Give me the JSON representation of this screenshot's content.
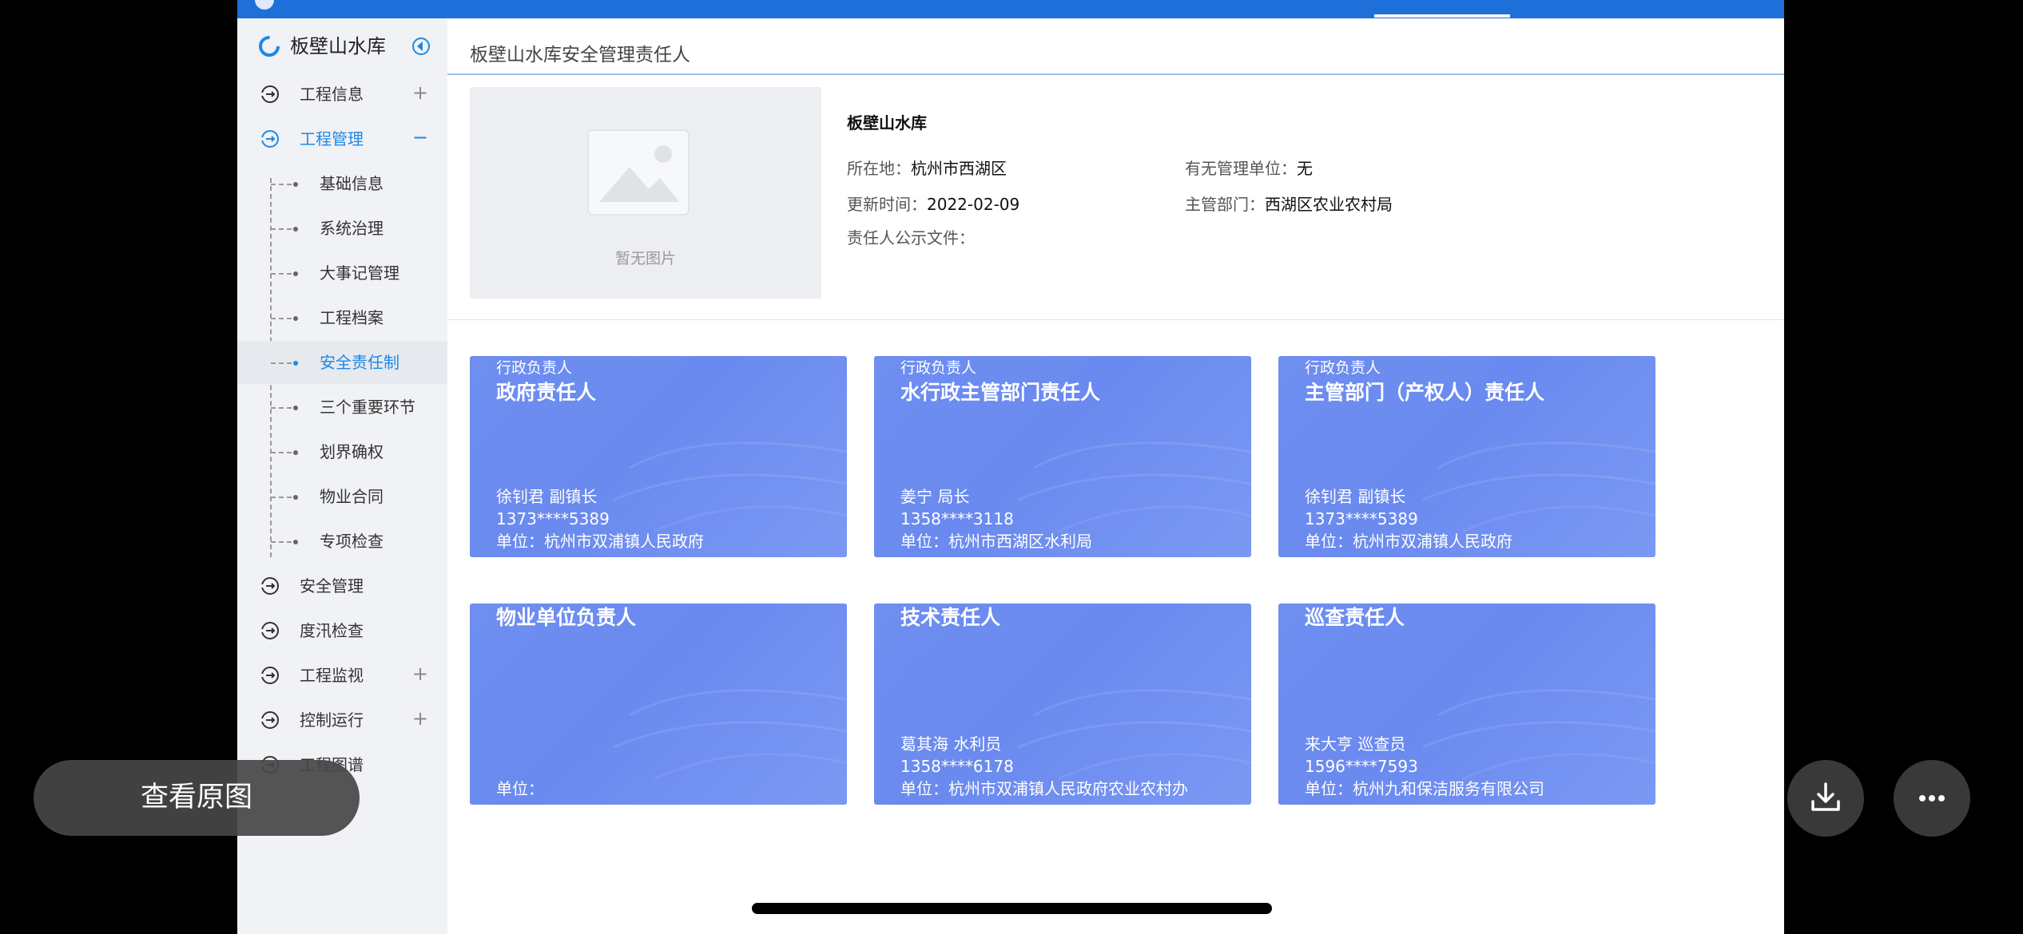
{
  "sidebar": {
    "title": "板壁山水库",
    "menu": [
      {
        "label": "工程信息",
        "toggle": "+"
      },
      {
        "label": "工程管理",
        "toggle": "−"
      },
      {
        "label": "安全管理",
        "toggle": ""
      },
      {
        "label": "度汛检查",
        "toggle": ""
      },
      {
        "label": "工程监视",
        "toggle": "+"
      },
      {
        "label": "控制运行",
        "toggle": "+"
      },
      {
        "label": "工程图谱",
        "toggle": ""
      }
    ],
    "submenu": [
      {
        "label": "基础信息"
      },
      {
        "label": "系统治理"
      },
      {
        "label": "大事记管理"
      },
      {
        "label": "工程档案"
      },
      {
        "label": "安全责任制"
      },
      {
        "label": "三个重要环节"
      },
      {
        "label": "划界确权"
      },
      {
        "label": "物业合同"
      },
      {
        "label": "专项检查"
      }
    ]
  },
  "main": {
    "page_title": "板壁山水库安全管理责任人",
    "photo_placeholder": "暂无图片",
    "project_name": "板壁山水库",
    "info": {
      "location_label": "所在地：",
      "location": "杭州市西湖区",
      "updated_label": "更新时间：",
      "updated": "2022-02-09",
      "doc_label": "责任人公示文件：",
      "mgmt_label": "有无管理单位：",
      "mgmt": "无",
      "dept_label": "主管部门：",
      "dept": "西湖区农业农村局"
    },
    "cards": [
      {
        "category": "行政负责人",
        "title": "政府责任人",
        "person": "徐钊君 副镇长",
        "phone": "1373****5389",
        "unit": "单位：杭州市双浦镇人民政府"
      },
      {
        "category": "行政负责人",
        "title": "水行政主管部门责任人",
        "person": "姜宁 局长",
        "phone": "1358****3118",
        "unit": "单位：杭州市西湖区水利局"
      },
      {
        "category": "行政负责人",
        "title": "主管部门（产权人）责任人",
        "person": "徐钊君 副镇长",
        "phone": "1373****5389",
        "unit": "单位：杭州市双浦镇人民政府"
      },
      {
        "category": "",
        "title": "物业单位负责人",
        "person": "",
        "phone": "",
        "unit": "单位："
      },
      {
        "category": "",
        "title": "技术责任人",
        "person": "葛其海 水利员",
        "phone": "1358****6178",
        "unit": "单位：杭州市双浦镇人民政府农业农村办"
      },
      {
        "category": "",
        "title": "巡查责任人",
        "person": "来大亨 巡查员",
        "phone": "1596****7593",
        "unit": "单位：杭州九和保洁服务有限公司"
      }
    ]
  },
  "overlay": {
    "view_original": "查看原图"
  },
  "colors": {
    "accent": "#1e88e5",
    "card": "#6f8ef0",
    "topbar": "#1e6fd9"
  },
  "icons": {
    "collapse": "collapse-icon",
    "menu": "circle-arrow-icon",
    "download": "download-icon",
    "more": "more-icon"
  }
}
